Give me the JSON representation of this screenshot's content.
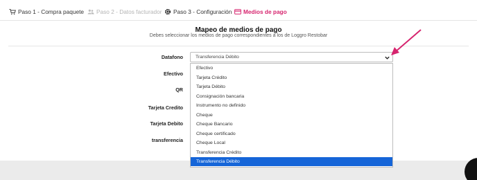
{
  "tabs": [
    {
      "label": "Paso 1 - Compra paquete",
      "icon": "cart-icon"
    },
    {
      "label": "Paso 2 - Datos facturador",
      "icon": "users-icon"
    },
    {
      "label": "Paso 3 - Configuración",
      "icon": "gear-icon"
    },
    {
      "label": "Medios de pago",
      "icon": "credit-card-icon"
    }
  ],
  "header": {
    "title": "Mapeo de medios de pago",
    "subtitle": "Debes seleccionar los medios de pago correspondientes a los de Loggro Restobar"
  },
  "fields": {
    "datafono": "Datafono",
    "efectivo": "Efectivo",
    "qr": "QR",
    "tarjeta_credito": "Tarjeta Credito",
    "tarjeta_debito": "Tarjeta Debito",
    "transferencia": "transferencia"
  },
  "select": {
    "value": "Transferencia Débito",
    "options": [
      "Efectivo",
      "Tarjeta Crédito",
      "Tarjeta Débito",
      "Consignación bancaria",
      "Instrumento no definido",
      "Cheque",
      "Cheque Bancario",
      "Cheque certificado",
      "Cheque Local",
      "Transferencia Crédito",
      "Transferencia Débito"
    ],
    "selected_index": 10
  },
  "colors": {
    "accent": "#d6246e",
    "selected_bg": "#1565d8",
    "annotation_arrow": "#d6246e"
  }
}
